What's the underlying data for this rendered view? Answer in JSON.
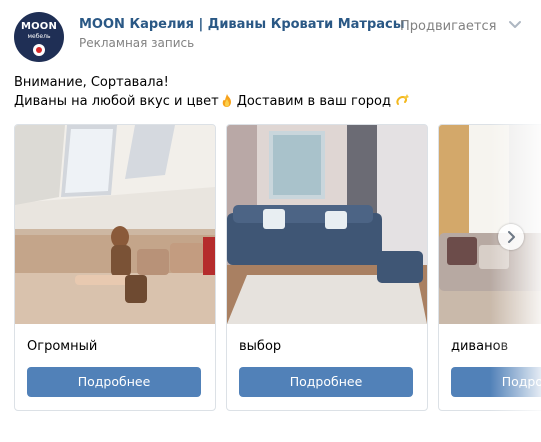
{
  "header": {
    "page_name": "MOON Карелия | Диваны Кровати Матрасы",
    "ad_label": "Рекламная запись",
    "promoted": "Продвигается",
    "logo_line1": "MOON",
    "logo_line2": "мебель"
  },
  "post": {
    "line1": "Внимание, Сортавала!",
    "line2a": "Диваны на любой вкус и цвет",
    "line2b": "Доставим в ваш город"
  },
  "cards": [
    {
      "title": "Огромный",
      "button": "Подробнее"
    },
    {
      "title": "выбор",
      "button": "Подробнее"
    },
    {
      "title": "диванов",
      "button": "Подробнее"
    }
  ],
  "icons": {
    "more": "chevron-down-icon",
    "next": "chevron-right-icon",
    "flame": "fire-emoji",
    "dizzy": "dizzy-emoji"
  },
  "colors": {
    "link": "#2a5885",
    "button": "#5181b8",
    "muted": "#828282"
  }
}
